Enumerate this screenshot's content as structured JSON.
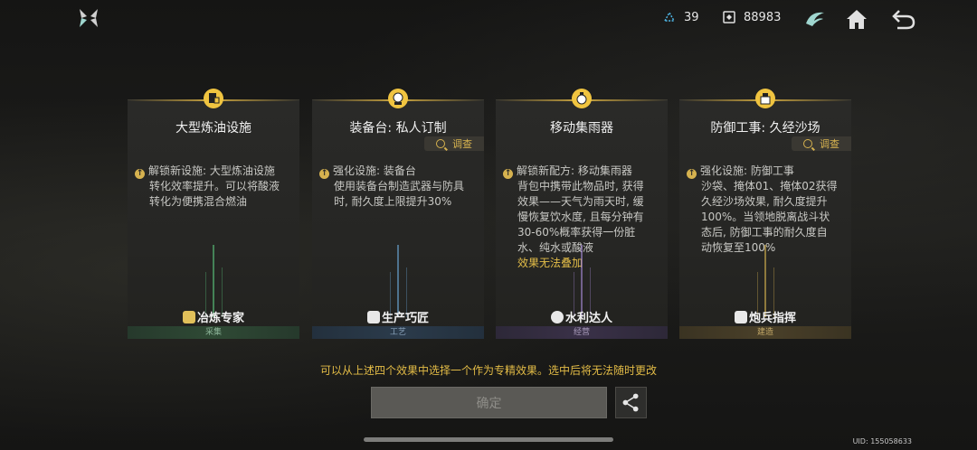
{
  "header": {
    "resources": [
      {
        "icon": "crystal-icon",
        "value": "39"
      },
      {
        "icon": "coin-icon",
        "value": "88983"
      }
    ],
    "buttons": [
      "tower-icon",
      "home-icon",
      "back-icon"
    ]
  },
  "cards": [
    {
      "title": "大型炼油设施",
      "show_investigate": false,
      "lines": [
        {
          "bullet": true,
          "text": "解锁新设施: 大型炼油设施"
        },
        {
          "text": "转化效率提升。可以将酸液"
        },
        {
          "text": "转化为便携混合燃油"
        }
      ],
      "note": "",
      "specialty": "冶炼专家",
      "category": "采集",
      "category_color": "#2f4a35"
    },
    {
      "title": "装备台: 私人订制",
      "show_investigate": true,
      "lines": [
        {
          "bullet": true,
          "text": "强化设施: 装备台"
        },
        {
          "text": "使用装备台制造武器与防具"
        },
        {
          "text": "时, 耐久度上限提升30%"
        }
      ],
      "note": "",
      "specialty": "生产巧匠",
      "category": "工艺",
      "category_color": "#2b3b4b"
    },
    {
      "title": "移动集雨器",
      "show_investigate": false,
      "lines": [
        {
          "bullet": true,
          "text": "解锁新配方: 移动集雨器"
        },
        {
          "text": "背包中携带此物品时, 获得"
        },
        {
          "text": "效果——天气为雨天时, 缓"
        },
        {
          "text": "慢恢复饮水度, 且每分钟有"
        },
        {
          "text": "30-60%概率获得一份脏"
        },
        {
          "text": "水、纯水或酸液"
        }
      ],
      "note": "效果无法叠加",
      "specialty": "水利达人",
      "category": "经营",
      "category_color": "#3a3148"
    },
    {
      "title": "防御工事: 久经沙场",
      "show_investigate": true,
      "lines": [
        {
          "bullet": true,
          "text": "强化设施: 防御工事"
        },
        {
          "text": "沙袋、掩体01、掩体02获得"
        },
        {
          "text": "久经沙场效果, 耐久度提升"
        },
        {
          "text": "100%。当领地脱离战斗状"
        },
        {
          "text": "态后, 防御工事的耐久度自"
        },
        {
          "text": "动恢复至100%"
        }
      ],
      "note": "",
      "specialty": "炮兵指挥",
      "category": "建造",
      "category_color": "#4a4029"
    }
  ],
  "investigate_label": "调查",
  "hint": "可以从上述四个效果中选择一个作为专精效果。选中后将无法随时更改",
  "confirm_label": "确定",
  "uid": "UID: 155058633"
}
